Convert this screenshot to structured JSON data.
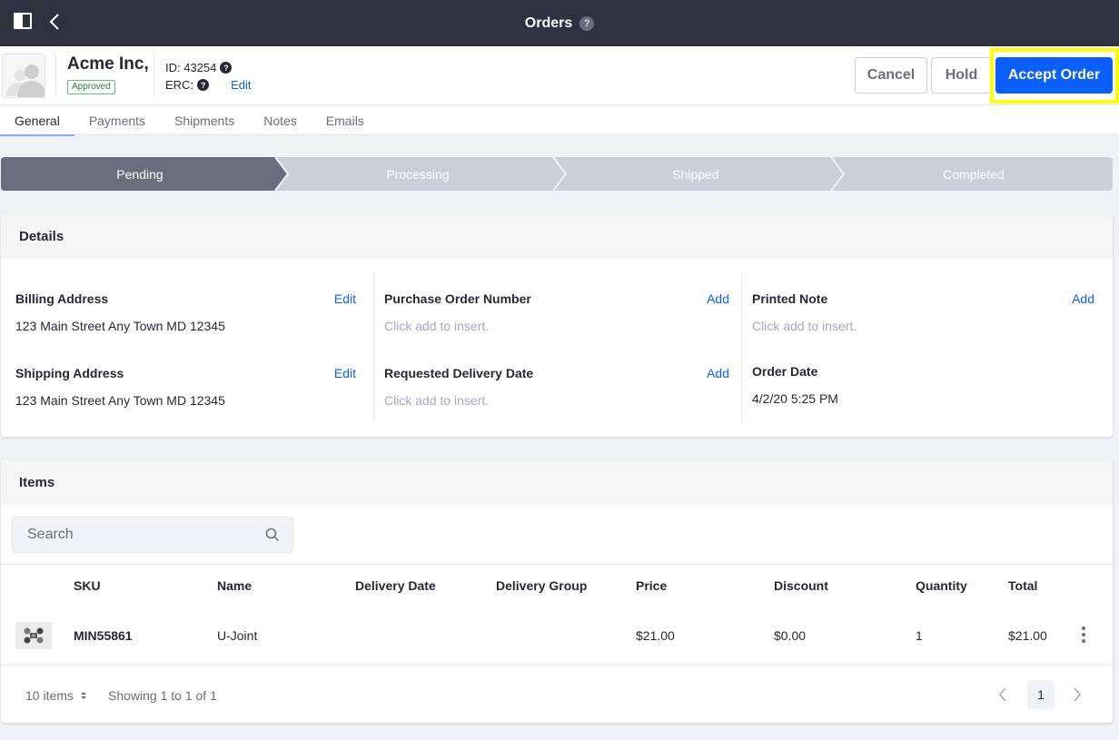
{
  "topbar": {
    "title": "Orders",
    "help_glyph": "?"
  },
  "header": {
    "company_name": "Acme Inc,",
    "status_badge": "Approved",
    "id_label": "ID: 43254",
    "erc_label": "ERC:",
    "help_glyph": "?",
    "edit_label": "Edit",
    "buttons": {
      "cancel": "Cancel",
      "hold": "Hold",
      "accept": "Accept Order"
    }
  },
  "tabs": [
    {
      "label": "General",
      "active": true
    },
    {
      "label": "Payments",
      "active": false
    },
    {
      "label": "Shipments",
      "active": false
    },
    {
      "label": "Notes",
      "active": false
    },
    {
      "label": "Emails",
      "active": false
    }
  ],
  "workflow": {
    "steps": [
      "Pending",
      "Processing",
      "Shipped",
      "Completed"
    ],
    "current_step": 0,
    "colors": {
      "active": "#6b6c7e",
      "inactive": "#cdced9"
    }
  },
  "details": {
    "title": "Details",
    "fields": {
      "billing": {
        "label": "Billing Address",
        "action": "Edit",
        "value": "123 Main Street Any Town MD 12345"
      },
      "shipping": {
        "label": "Shipping Address",
        "action": "Edit",
        "value": "123 Main Street Any Town MD 12345"
      },
      "po_number": {
        "label": "Purchase Order Number",
        "action": "Add",
        "value": "Click add to insert."
      },
      "delivery_date": {
        "label": "Requested Delivery Date",
        "action": "Add",
        "value": "Click add to insert."
      },
      "printed_note": {
        "label": "Printed Note",
        "action": "Add",
        "value": "Click add to insert."
      },
      "order_date": {
        "label": "Order Date",
        "value": "4/2/20 5:25 PM"
      }
    }
  },
  "items": {
    "title": "Items",
    "search_placeholder": "Search",
    "columns": [
      "SKU",
      "Name",
      "Delivery Date",
      "Delivery Group",
      "Price",
      "Discount",
      "Quantity",
      "Total"
    ],
    "rows": [
      {
        "sku": "MIN55861",
        "name": "U-Joint",
        "delivery_date": "",
        "delivery_group": "",
        "price": "$21.00",
        "discount": "$0.00",
        "quantity": "1",
        "total": "$21.00"
      }
    ],
    "footer": {
      "page_size": "10 items",
      "showing": "Showing 1 to 1 of 1",
      "current_page": "1"
    }
  },
  "colors": {
    "primary": "#0b5fff",
    "topbar": "#30313f",
    "highlight": "#ffff00"
  }
}
